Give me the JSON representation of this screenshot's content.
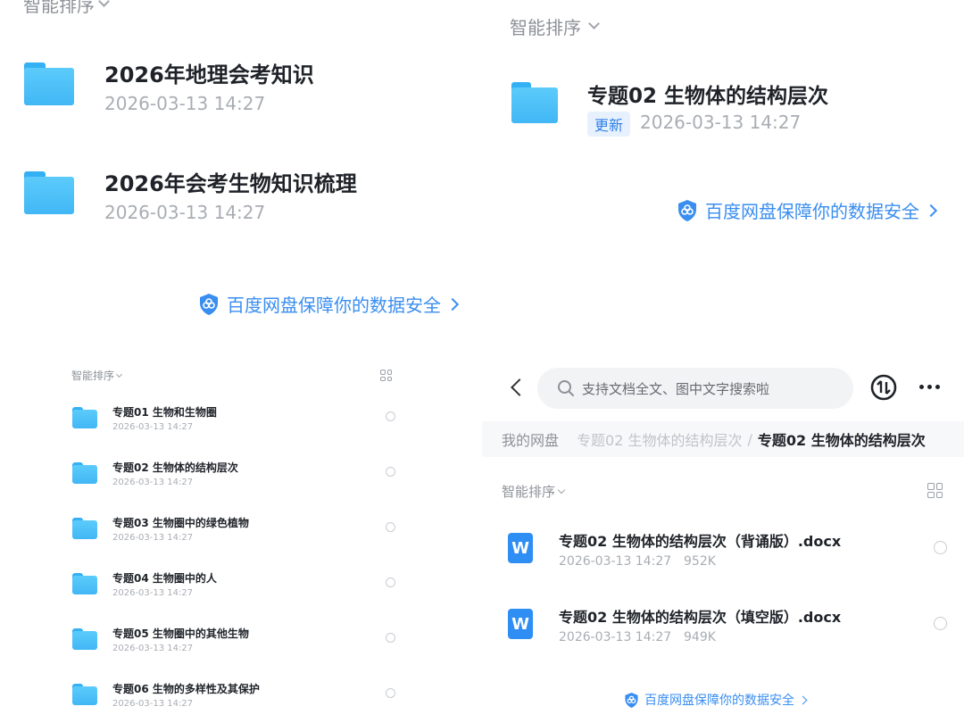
{
  "panel_tl": {
    "sort_label": "智能排序",
    "folders": [
      {
        "name": "2026年地理会考知识",
        "date": "2026-03-13 14:27"
      },
      {
        "name": "2026年会考生物知识梳理",
        "date": "2026-03-13 14:27"
      }
    ],
    "security": "百度网盘保障你的数据安全"
  },
  "panel_tr": {
    "sort_label": "智能排序",
    "folder": {
      "name": "专题02 生物体的结构层次",
      "badge": "更新",
      "date": "2026-03-13 14:27"
    },
    "security": "百度网盘保障你的数据安全"
  },
  "panel_bl": {
    "sort_label": "智能排序",
    "items": [
      {
        "name": "专题01 生物和生物圈",
        "date": "2026-03-13 14:27"
      },
      {
        "name": "专题02 生物体的结构层次",
        "date": "2026-03-13 14:27"
      },
      {
        "name": "专题03 生物圈中的绿色植物",
        "date": "2026-03-13 14:27"
      },
      {
        "name": "专题04 生物圈中的人",
        "date": "2026-03-13 14:27"
      },
      {
        "name": "专题05 生物圈中的其他生物",
        "date": "2026-03-13 14:27"
      },
      {
        "name": "专题06 生物的多样性及其保护",
        "date": "2026-03-13 14:27"
      }
    ]
  },
  "panel_br": {
    "search_placeholder": "支持文档全文、图中文字搜索啦",
    "breadcrumb": [
      "我的网盘",
      "专题02 生物体的结构层次",
      "/",
      "专题02 生物体的结构层次"
    ],
    "sort_label": "智能排序",
    "files": [
      {
        "name": "专题02 生物体的结构层次（背诵版）.docx",
        "date": "2026-03-13 14:27",
        "size": "952K",
        "icon": "W"
      },
      {
        "name": "专题02 生物体的结构层次（填空版）.docx",
        "date": "2026-03-13 14:27",
        "size": "949K",
        "icon": "W"
      }
    ],
    "security": "百度网盘保障你的数据安全"
  }
}
